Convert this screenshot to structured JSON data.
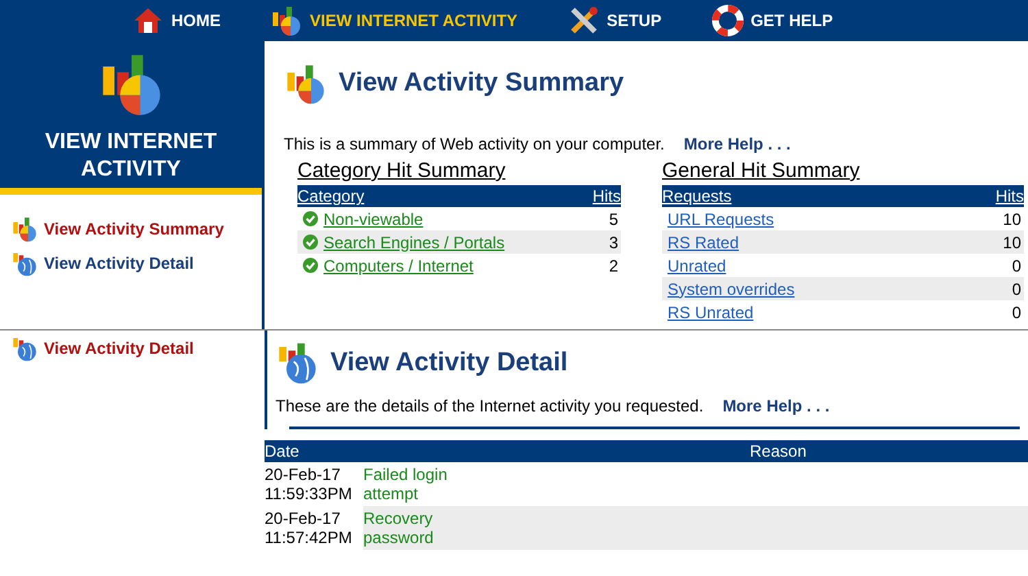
{
  "nav": [
    {
      "label": "HOME",
      "selected": false
    },
    {
      "label": "VIEW INTERNET ACTIVITY",
      "selected": true
    },
    {
      "label": "SETUP",
      "selected": false
    },
    {
      "label": "GET HELP",
      "selected": false
    }
  ],
  "summary_screen": {
    "sidebar": {
      "title": "VIEW INTERNET ACTIVITY",
      "items": [
        {
          "label": "View Activity Summary",
          "selected": true
        },
        {
          "label": "View Activity Detail",
          "selected": false
        }
      ]
    },
    "heading": "View Activity Summary",
    "intro": "This is a summary of Web activity on your computer.",
    "more_help": "More Help . . .",
    "tables": [
      {
        "title": "Category Hit Summary",
        "columns": [
          "Category",
          "Hits"
        ],
        "rows": [
          {
            "name": "Non-viewable",
            "hits": "5"
          },
          {
            "name": "Search Engines / Portals",
            "hits": "3"
          },
          {
            "name": "Computers / Internet",
            "hits": "2"
          }
        ]
      },
      {
        "title": "General Hit Summary",
        "columns": [
          "Requests",
          "Hits"
        ],
        "rows": [
          {
            "name": "URL Requests",
            "hits": "10"
          },
          {
            "name": "RS Rated",
            "hits": "10"
          },
          {
            "name": "Unrated",
            "hits": "0"
          },
          {
            "name": "System overrides",
            "hits": "0"
          },
          {
            "name": "RS Unrated",
            "hits": "0"
          }
        ]
      }
    ]
  },
  "detail_screen": {
    "sidebar": {
      "items": [
        {
          "label": "View Activity Detail",
          "selected": true
        }
      ]
    },
    "heading": "View Activity Detail",
    "intro": "These are the details of the Internet activity you requested.",
    "more_help": "More Help . . .",
    "table": {
      "columns": [
        "Date",
        "Reason"
      ],
      "rows": [
        {
          "date": "20-Feb-17 11:59:33PM",
          "event": "Failed login attempt"
        },
        {
          "date": "20-Feb-17 11:57:42PM",
          "event": "Recovery password"
        }
      ]
    }
  }
}
